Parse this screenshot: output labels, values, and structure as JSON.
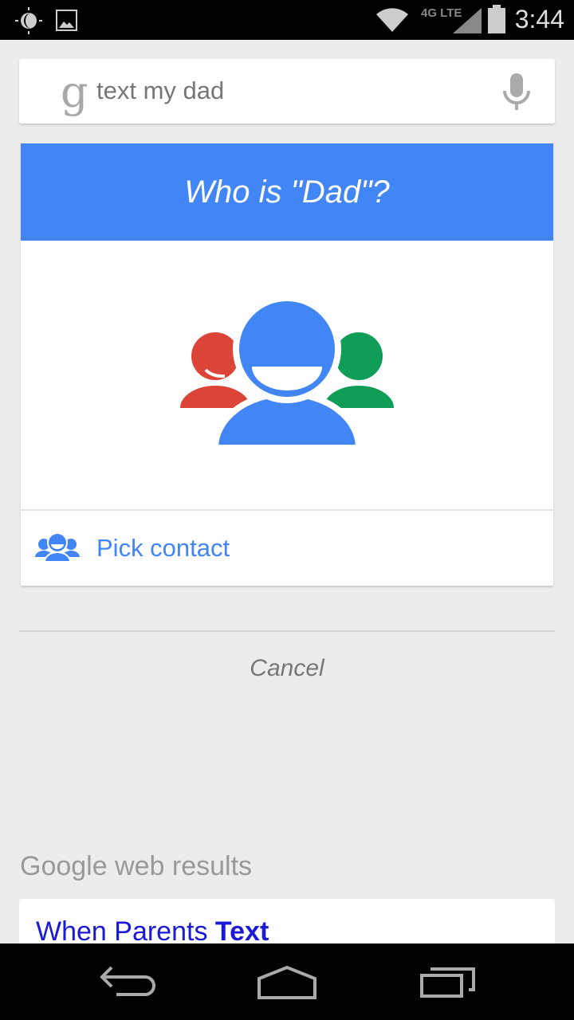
{
  "status_bar": {
    "time": "3:44",
    "network": "4G LTE",
    "icons": [
      "brightness-icon",
      "image-notification-icon",
      "wifi-icon",
      "signal-icon",
      "battery-icon"
    ]
  },
  "search": {
    "logo": "g",
    "query": "text my dad",
    "mic_icon": "microphone-icon"
  },
  "card": {
    "title": "Who is \"Dad\"?",
    "pick_contact": "Pick contact",
    "header_color": "#4285f4",
    "illustration_colors": {
      "left": "#db4437",
      "center": "#4285f4",
      "right": "#0f9d58"
    }
  },
  "cancel": "Cancel",
  "web_results": {
    "header": "Google web results",
    "first_result": {
      "text_normal": "When Parents ",
      "text_bold": "Text"
    }
  },
  "nav_bar": {
    "icons": [
      "back-icon",
      "home-icon",
      "recents-icon"
    ]
  }
}
